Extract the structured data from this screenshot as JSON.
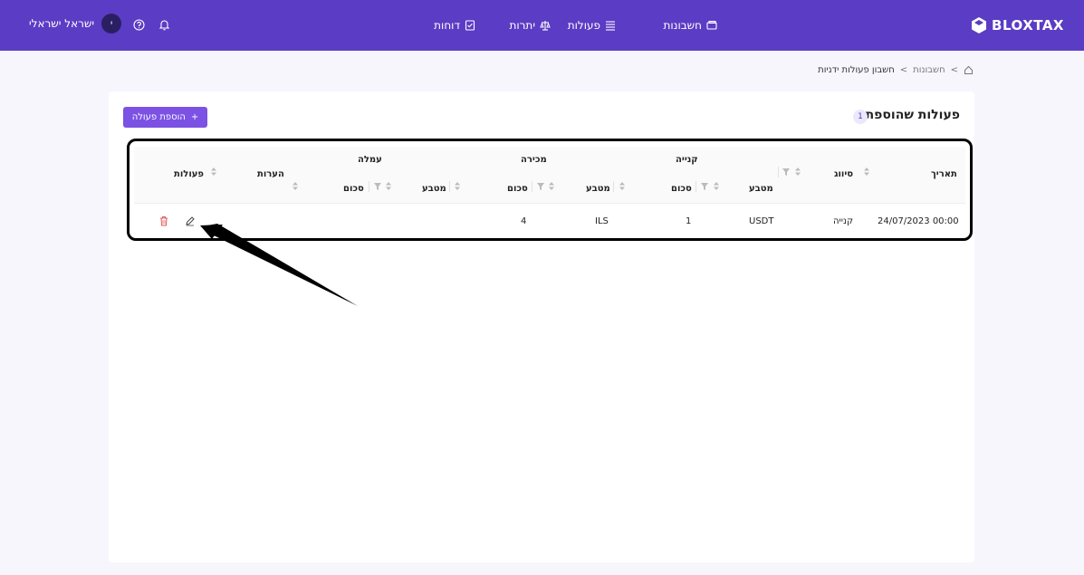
{
  "header": {
    "logo_text": "BLOXTAX",
    "nav": {
      "accounts": "חשבונות",
      "transactions": "פעולות",
      "balances": "יתרות",
      "reports": "דוחות"
    },
    "user_name": "ישראל ישראלי",
    "avatar_initial": "י"
  },
  "breadcrumb": {
    "parent": "חשבונות",
    "separator": ">",
    "current": "חשבון פעולות ידניות"
  },
  "card": {
    "title": "פעולות שהוספת",
    "count": "1",
    "add_button": "הוספת פעולה",
    "add_plus": "+"
  },
  "table": {
    "headers": {
      "date": "תאריך",
      "type": "סיווג",
      "buy": "קנייה",
      "buy_currency": "מטבע",
      "buy_amount": "סכום",
      "sell": "מכירה",
      "sell_currency": "מטבע",
      "sell_amount": "סכום",
      "fee": "עמלה",
      "fee_currency": "מטבע",
      "fee_amount": "סכום",
      "notes": "הערות",
      "actions": "פעולות"
    },
    "rows": [
      {
        "date": "24/07/2023 00:00",
        "type": "קנייה",
        "buy_currency": "USDT",
        "buy_amount": "1",
        "sell_currency": "ILS",
        "sell_amount": "4"
      }
    ]
  },
  "colors": {
    "brand": "#5b3cc4",
    "button": "#7b52e3",
    "delete": "#e05a5a"
  }
}
